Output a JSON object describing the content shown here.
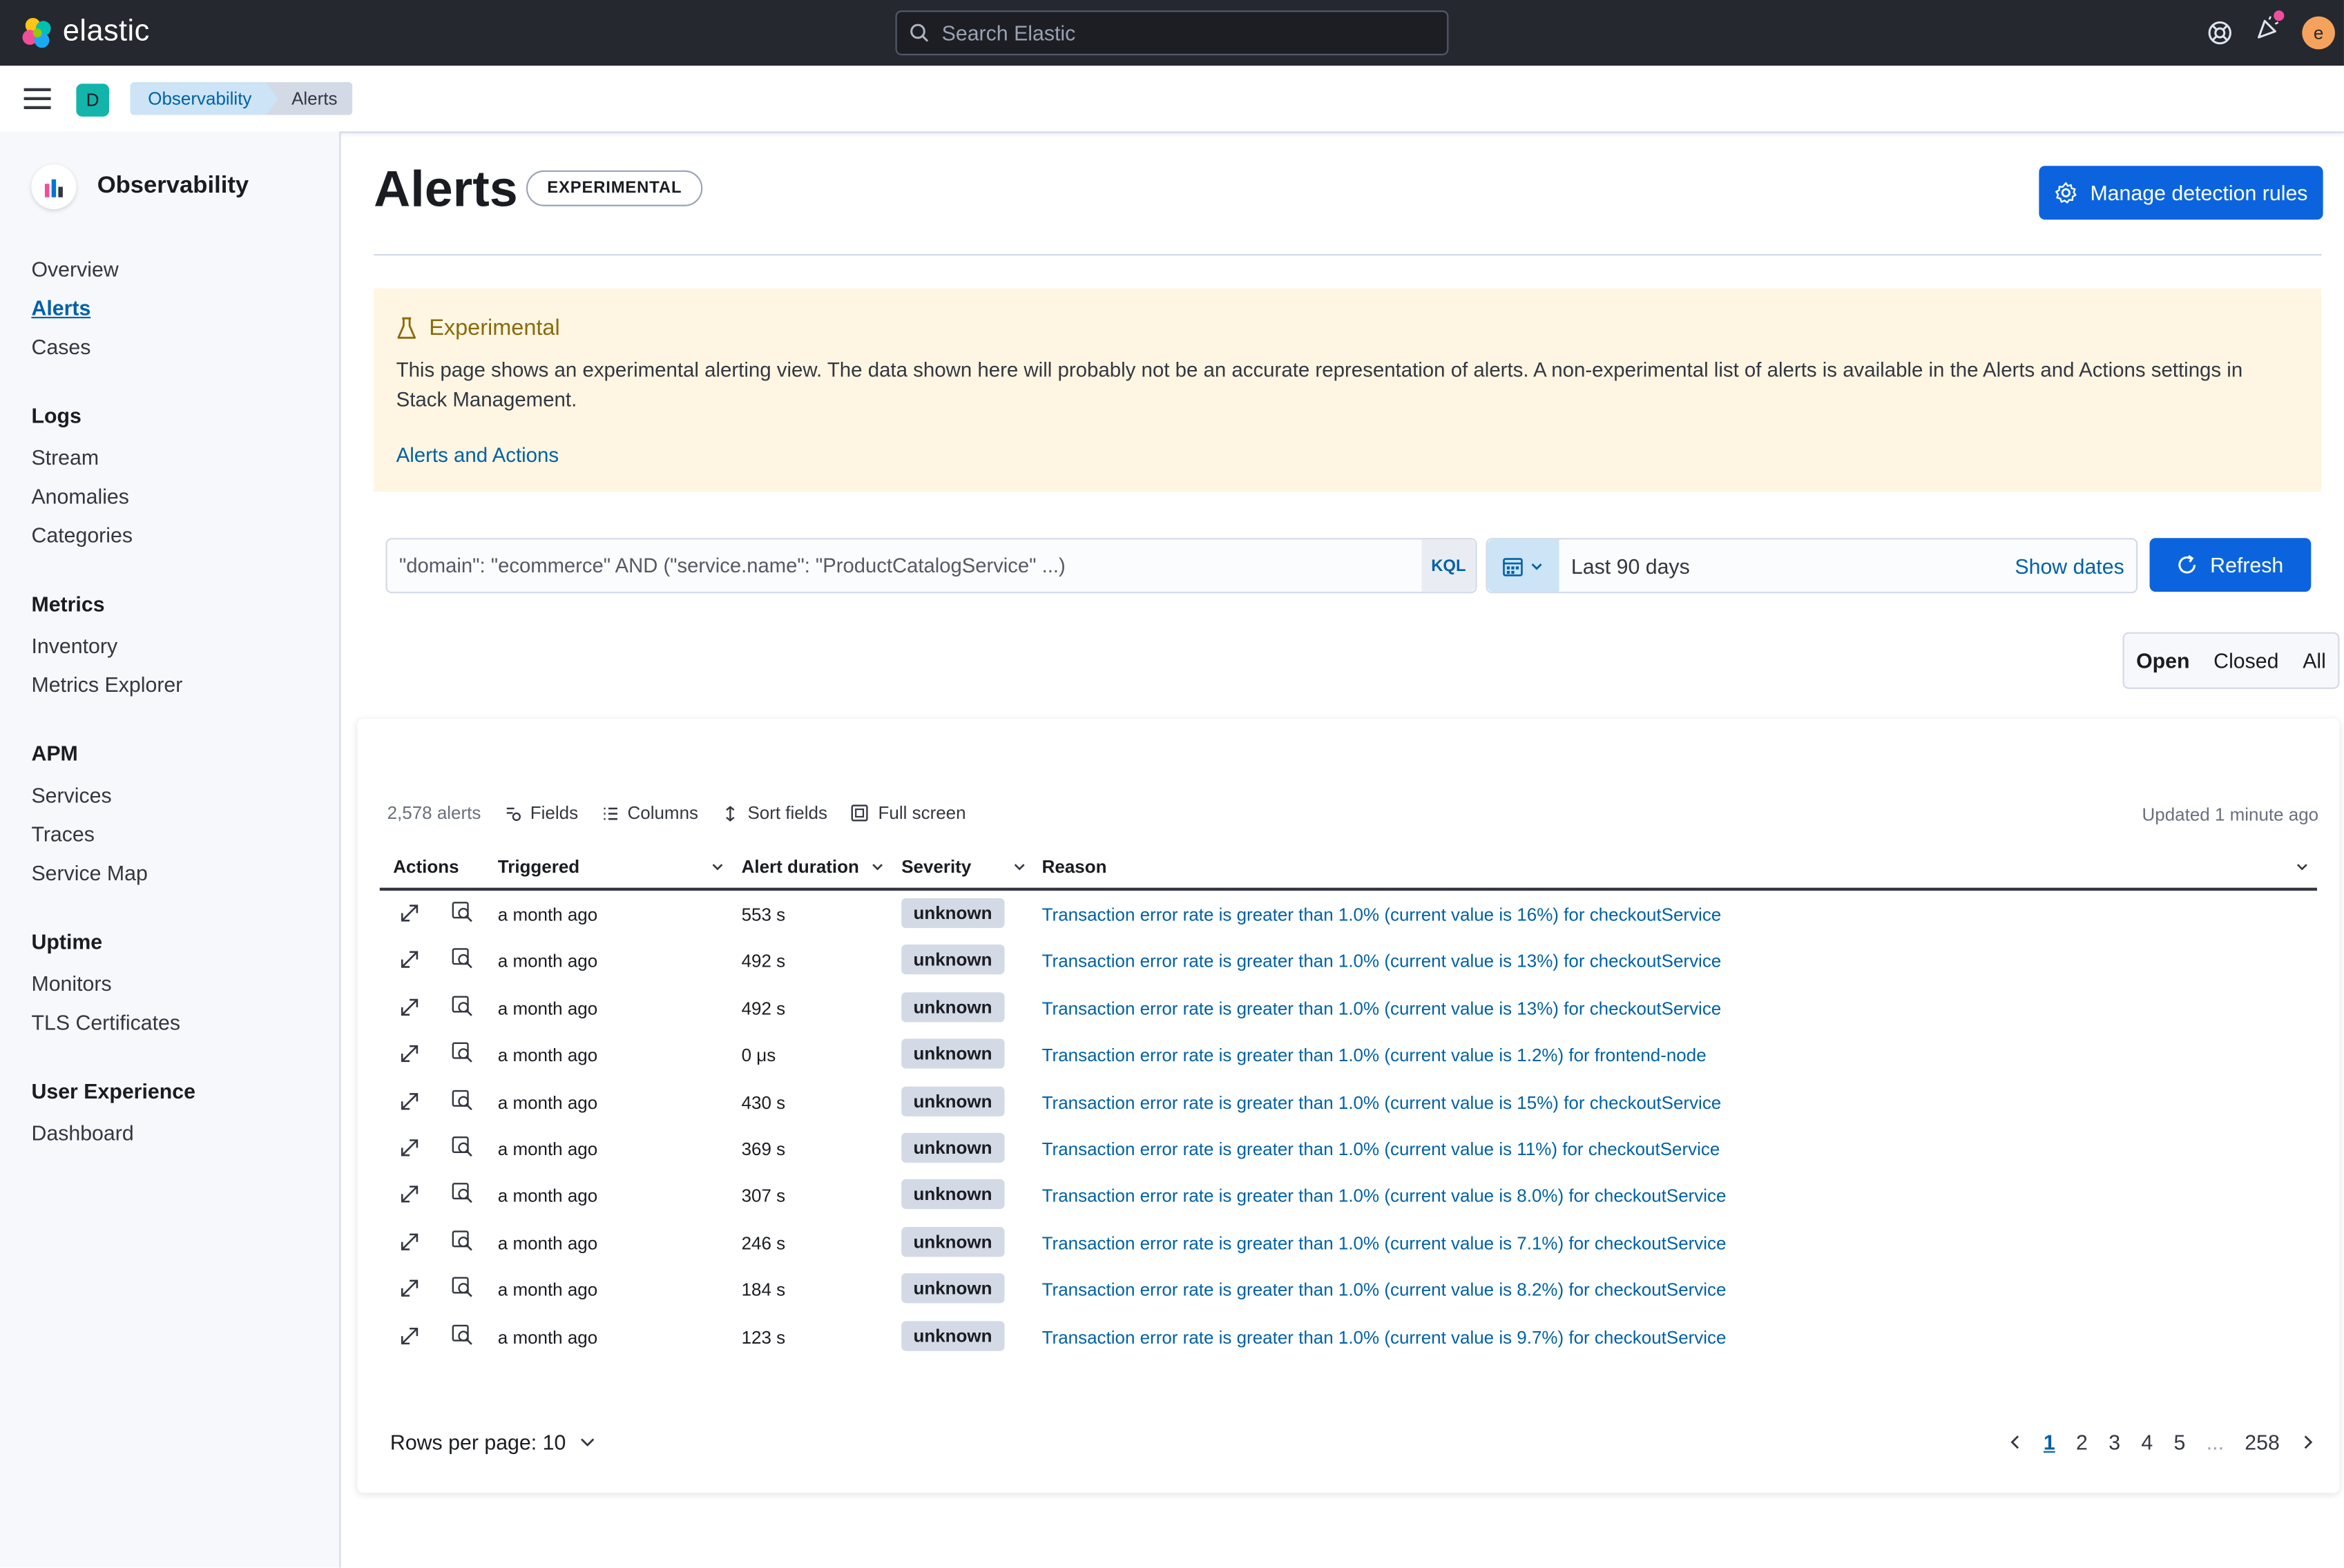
{
  "topbar": {
    "brand": "elastic",
    "search_placeholder": "Search Elastic",
    "user_initial": "e"
  },
  "breadcrumbs": {
    "space_initial": "D",
    "items": [
      "Observability",
      "Alerts"
    ]
  },
  "sidebar": {
    "title": "Observability",
    "sections": [
      {
        "label": "",
        "items": [
          "Overview",
          "Alerts",
          "Cases"
        ]
      },
      {
        "label": "Logs",
        "items": [
          "Stream",
          "Anomalies",
          "Categories"
        ]
      },
      {
        "label": "Metrics",
        "items": [
          "Inventory",
          "Metrics Explorer"
        ]
      },
      {
        "label": "APM",
        "items": [
          "Services",
          "Traces",
          "Service Map"
        ]
      },
      {
        "label": "Uptime",
        "items": [
          "Monitors",
          "TLS Certificates"
        ]
      },
      {
        "label": "User Experience",
        "items": [
          "Dashboard"
        ]
      }
    ],
    "active_item": "Alerts"
  },
  "page": {
    "title": "Alerts",
    "badge": "EXPERIMENTAL",
    "manage_button": "Manage detection rules"
  },
  "callout": {
    "title": "Experimental",
    "body": "This page shows an experimental alerting view. The data shown here will probably not be an accurate representation of alerts. A non-experimental list of alerts is available in the Alerts and Actions settings in Stack Management.",
    "link": "Alerts and Actions"
  },
  "filters": {
    "query": "\"domain\": \"ecommerce\" AND (\"service.name\": \"ProductCatalogService\" ...)",
    "query_language": "KQL",
    "date_range": "Last 90 days",
    "show_dates": "Show dates",
    "refresh": "Refresh",
    "status_options": [
      "Open",
      "Closed",
      "All"
    ],
    "status_selected": "Open"
  },
  "table": {
    "count": "2,578 alerts",
    "toolbar": [
      "Fields",
      "Columns",
      "Sort fields",
      "Full screen"
    ],
    "updated": "Updated 1 minute ago",
    "columns": [
      "Actions",
      "Triggered",
      "Alert duration",
      "Severity",
      "Reason"
    ],
    "rows": [
      {
        "triggered": "a month ago",
        "duration": "553 s",
        "severity": "unknown",
        "reason": "Transaction error rate is greater than 1.0% (current value is 16%) for checkoutService"
      },
      {
        "triggered": "a month ago",
        "duration": "492 s",
        "severity": "unknown",
        "reason": "Transaction error rate is greater than 1.0% (current value is 13%) for checkoutService"
      },
      {
        "triggered": "a month ago",
        "duration": "492 s",
        "severity": "unknown",
        "reason": "Transaction error rate is greater than 1.0% (current value is 13%) for checkoutService"
      },
      {
        "triggered": "a month ago",
        "duration": "0 μs",
        "severity": "unknown",
        "reason": "Transaction error rate is greater than 1.0% (current value is 1.2%) for frontend-node"
      },
      {
        "triggered": "a month ago",
        "duration": "430 s",
        "severity": "unknown",
        "reason": "Transaction error rate is greater than 1.0% (current value is 15%) for checkoutService"
      },
      {
        "triggered": "a month ago",
        "duration": "369 s",
        "severity": "unknown",
        "reason": "Transaction error rate is greater than 1.0% (current value is 11%) for checkoutService"
      },
      {
        "triggered": "a month ago",
        "duration": "307 s",
        "severity": "unknown",
        "reason": "Transaction error rate is greater than 1.0% (current value is 8.0%) for checkoutService"
      },
      {
        "triggered": "a month ago",
        "duration": "246 s",
        "severity": "unknown",
        "reason": "Transaction error rate is greater than 1.0% (current value is 7.1%) for checkoutService"
      },
      {
        "triggered": "a month ago",
        "duration": "184 s",
        "severity": "unknown",
        "reason": "Transaction error rate is greater than 1.0% (current value is 8.2%) for checkoutService"
      },
      {
        "triggered": "a month ago",
        "duration": "123 s",
        "severity": "unknown",
        "reason": "Transaction error rate is greater than 1.0% (current value is 9.7%) for checkoutService"
      }
    ]
  },
  "pagination": {
    "rows_per_page": "Rows per page: 10",
    "pages": [
      "1",
      "2",
      "3",
      "4",
      "5"
    ],
    "ellipsis": "...",
    "last_page": "258",
    "current_page": "1"
  },
  "colors": {
    "primary": "#0b64dd",
    "link": "#0061a6",
    "header_bg": "#25282f",
    "callout_bg": "#fef6e2",
    "callout_title": "#8a6a0a"
  }
}
